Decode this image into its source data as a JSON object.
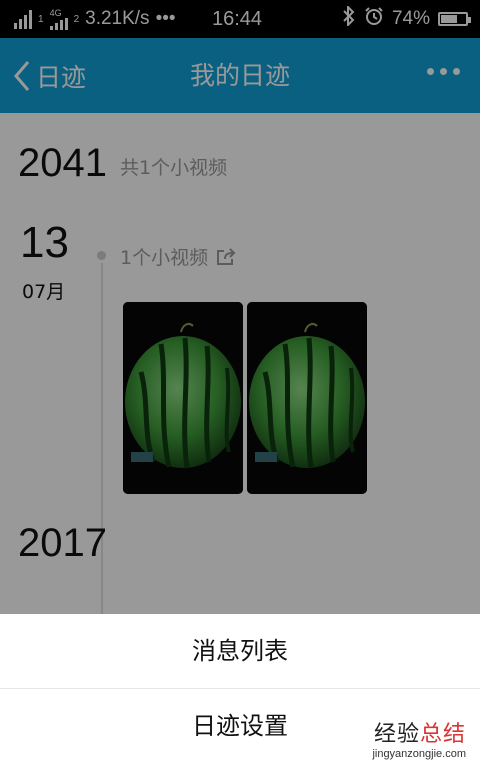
{
  "status_bar": {
    "network_speed": "3.21K/s",
    "dots": "•••",
    "sim1": "1",
    "sim2_tag": "4G",
    "sim2": "2",
    "time": "16:44",
    "battery": "74%",
    "battery_level": 0.74
  },
  "header": {
    "back_label": "日迹",
    "title": "我的日迹"
  },
  "timeline": {
    "year1": "2041",
    "year1_count": "共1个小视频",
    "day": "13",
    "month": "07月",
    "entry_label": "1个小视频",
    "year2": "2017"
  },
  "sheet": {
    "item1": "消息列表",
    "item2": "日迹设置"
  },
  "watermark": {
    "cn_part1": "经验",
    "cn_part2": "总结",
    "url": "jingyanzongjie.com"
  },
  "colors": {
    "header_bg": "#12a0d6",
    "overlay": "rgba(0,0,0,0.40)"
  }
}
